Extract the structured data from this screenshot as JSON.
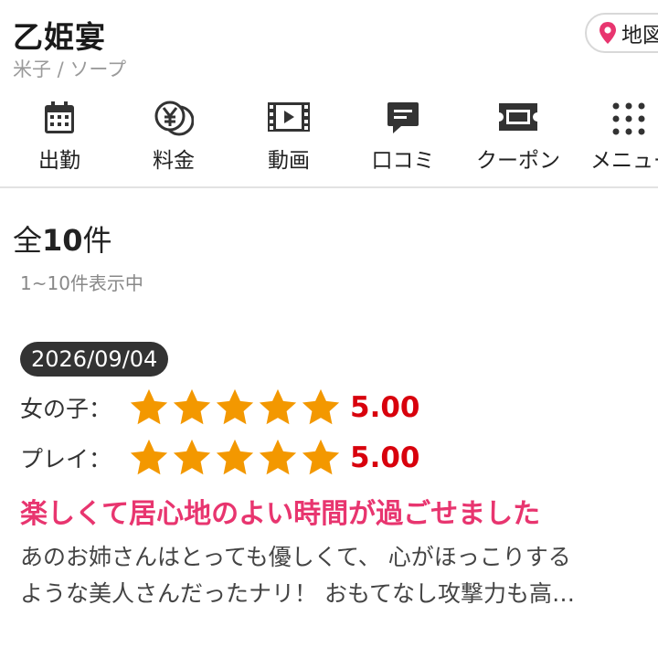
{
  "shop": {
    "name": "乙姫宴",
    "subtitle": "米子 / ソープ",
    "map_label": "地図"
  },
  "nav": {
    "items": [
      {
        "label": "出勤",
        "icon": "calendar-icon"
      },
      {
        "label": "料金",
        "icon": "yen-coins-icon"
      },
      {
        "label": "動画",
        "icon": "film-icon"
      },
      {
        "label": "口コミ",
        "icon": "speech-bubble-icon"
      },
      {
        "label": "クーポン",
        "icon": "ticket-icon"
      },
      {
        "label": "メニュー",
        "icon": "grid-dots-icon"
      }
    ]
  },
  "reviews": {
    "total_prefix": "全",
    "total_count": "10",
    "total_suffix": "件",
    "range_text": "1~10件表示中",
    "items": [
      {
        "date": "2026/09/04",
        "ratings": [
          {
            "label": "女の子：",
            "stars": 5,
            "score": "5.00"
          },
          {
            "label": "プレイ：",
            "stars": 5,
            "score": "5.00"
          }
        ],
        "title": "楽しくて居心地のよい時間が過ごせました",
        "body_line1": "あのお姉さんはとっても優しくて、 心がほっこりする",
        "body_line2": "ような美人さんだったナリ！ おもてなし攻撃力も高…"
      }
    ]
  },
  "colors": {
    "accent_pink": "#e8356f",
    "score_red": "#d8000c",
    "star_orange": "#f39800",
    "badge_dark": "#333333",
    "map_pin": "#e8356f"
  }
}
